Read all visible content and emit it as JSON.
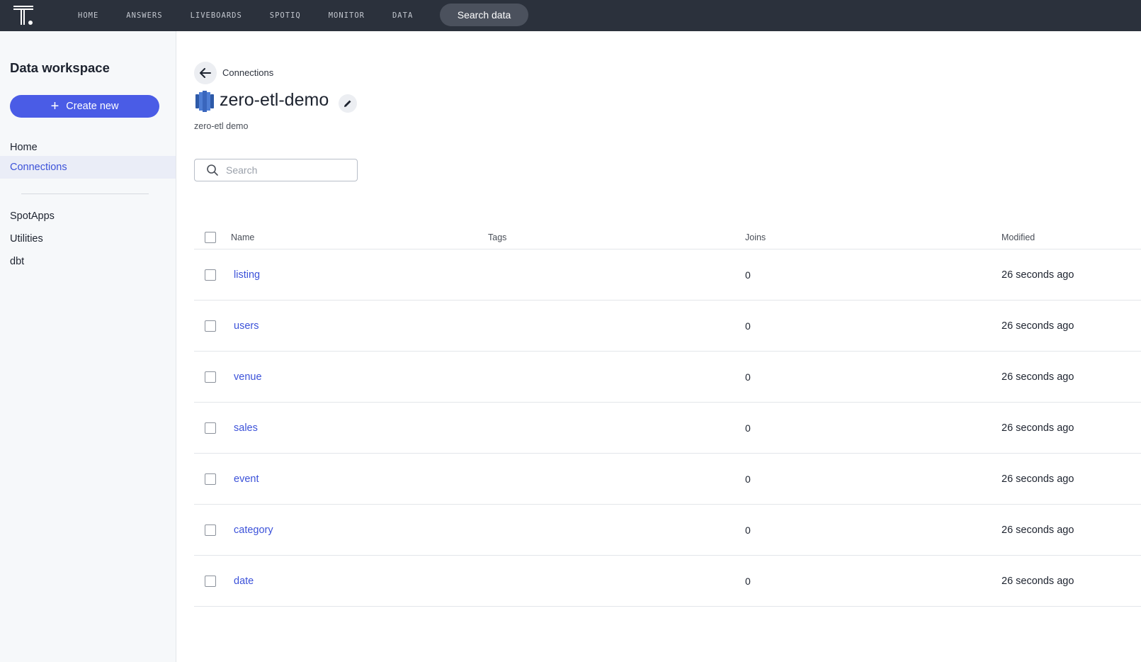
{
  "nav": {
    "items": [
      "HOME",
      "ANSWERS",
      "LIVEBOARDS",
      "SPOTIQ",
      "MONITOR",
      "DATA"
    ],
    "search_button": "Search data"
  },
  "sidebar": {
    "title": "Data workspace",
    "create_label": "Create new",
    "items": [
      {
        "label": "Home",
        "active": false
      },
      {
        "label": "Connections",
        "active": true
      }
    ],
    "items2": [
      {
        "label": "SpotApps"
      },
      {
        "label": "Utilities"
      },
      {
        "label": "dbt"
      }
    ]
  },
  "main": {
    "breadcrumb": "Connections",
    "title": "zero-etl-demo",
    "subtitle": "zero-etl demo",
    "search_placeholder": "Search"
  },
  "table": {
    "headers": {
      "name": "Name",
      "tags": "Tags",
      "joins": "Joins",
      "modified": "Modified"
    },
    "rows": [
      {
        "name": "listing",
        "joins": "0",
        "modified": "26 seconds ago"
      },
      {
        "name": "users",
        "joins": "0",
        "modified": "26 seconds ago"
      },
      {
        "name": "venue",
        "joins": "0",
        "modified": "26 seconds ago"
      },
      {
        "name": "sales",
        "joins": "0",
        "modified": "26 seconds ago"
      },
      {
        "name": "event",
        "joins": "0",
        "modified": "26 seconds ago"
      },
      {
        "name": "category",
        "joins": "0",
        "modified": "26 seconds ago"
      },
      {
        "name": "date",
        "joins": "0",
        "modified": "26 seconds ago"
      }
    ]
  },
  "colors": {
    "topbar": "#2b313c",
    "accent": "#4a5ce6",
    "link": "#3c52d9"
  }
}
